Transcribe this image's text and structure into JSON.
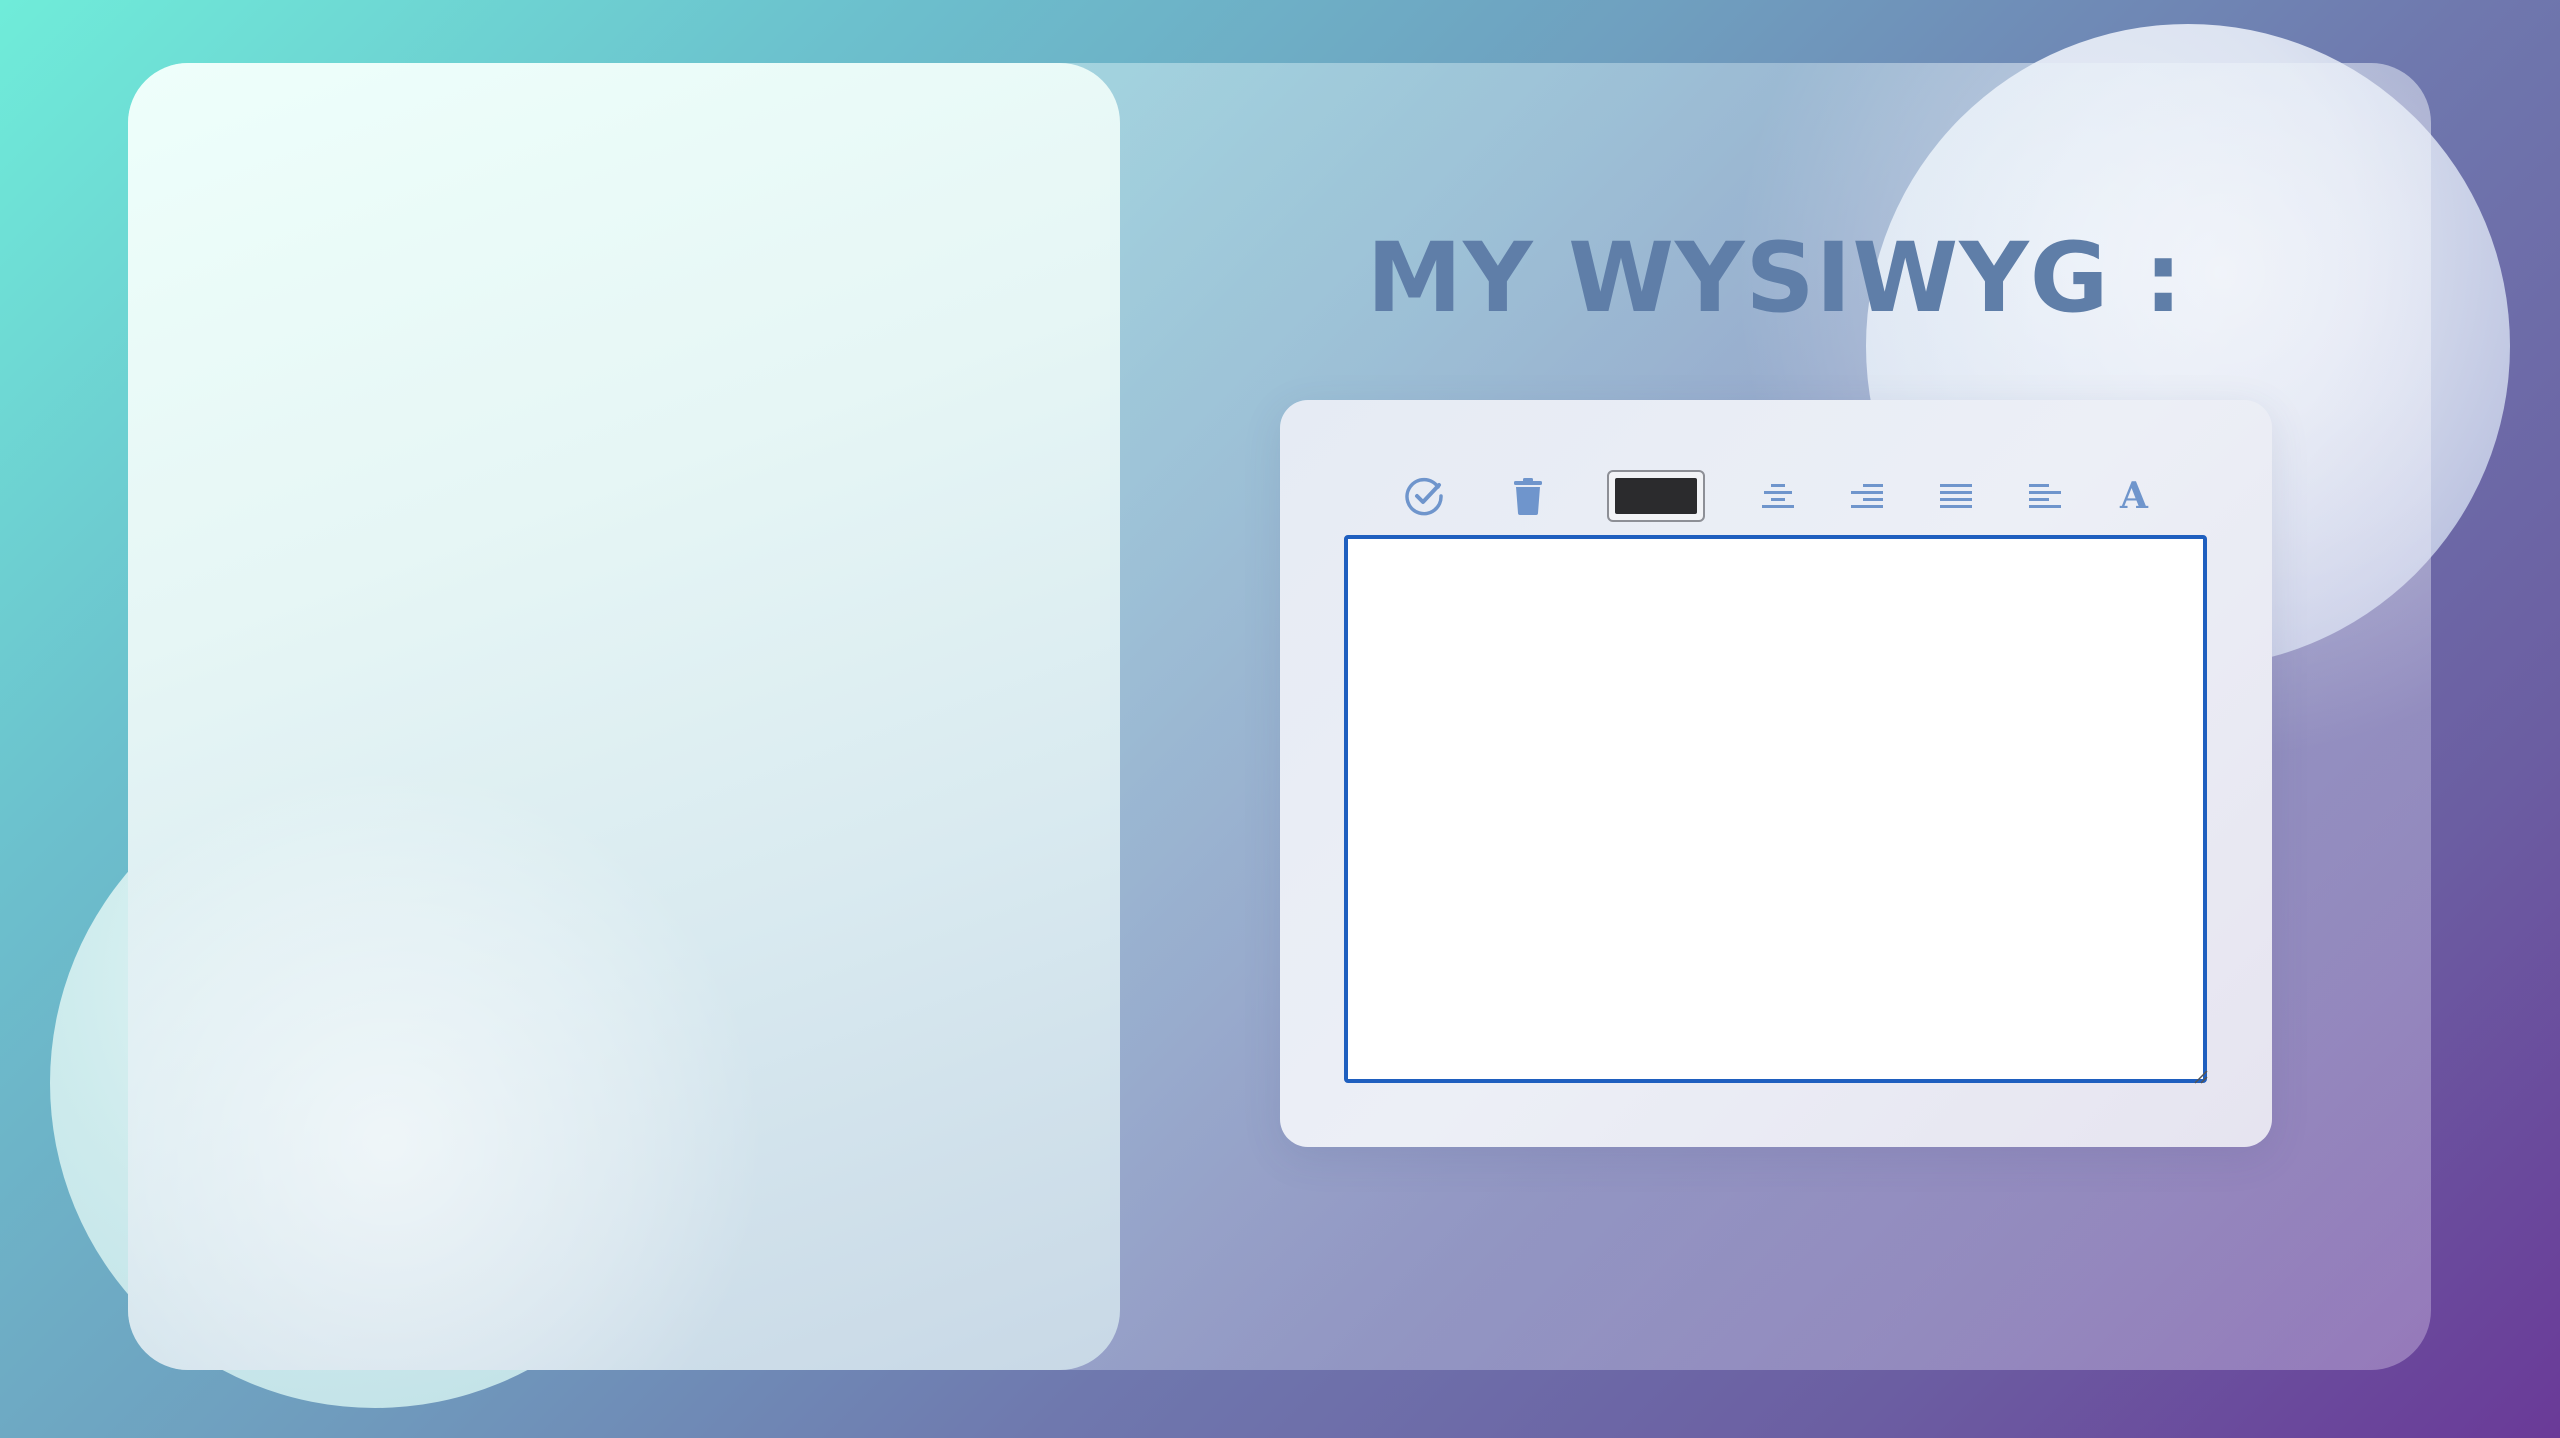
{
  "page": {
    "title": "MY WYSIWYG :"
  },
  "toolbar": {
    "tools": [
      {
        "name": "validate",
        "icon": "check-circle-icon"
      },
      {
        "name": "delete",
        "icon": "trash-icon"
      },
      {
        "name": "text-color",
        "icon": "color-swatch",
        "value": "#2b2b2d"
      },
      {
        "name": "align-center",
        "icon": "align-center-icon"
      },
      {
        "name": "align-right",
        "icon": "align-right-icon"
      },
      {
        "name": "align-justify",
        "icon": "align-justify-icon"
      },
      {
        "name": "align-left",
        "icon": "align-left-icon"
      },
      {
        "name": "font",
        "icon": "font-icon",
        "label": "A"
      }
    ]
  },
  "editor": {
    "content": ""
  },
  "colors": {
    "accent": "#1f5fbf",
    "icon": "#6f95cc",
    "title": "#5f7ea8",
    "swatch": "#2b2b2d"
  }
}
